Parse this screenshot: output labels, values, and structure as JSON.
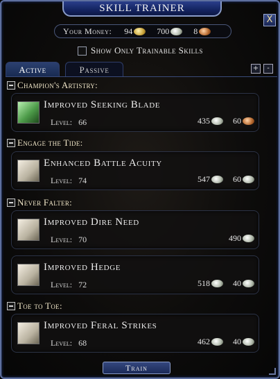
{
  "window": {
    "title": "Skill Trainer",
    "close_glyph": "X"
  },
  "money": {
    "label": "Your Money:",
    "gold": "94",
    "silver": "700",
    "copper": "8"
  },
  "filter": {
    "label": "Show Only Trainable Skills",
    "checked": false
  },
  "tabs": [
    {
      "label": "Active",
      "selected": true
    },
    {
      "label": "Passive",
      "selected": false
    }
  ],
  "sections": [
    {
      "title": "Champion's Artistry:",
      "skills": [
        {
          "name": "Improved Seeking Blade",
          "level_label": "Level:",
          "level": "66",
          "cost_silver": "435",
          "cost_other": "60",
          "other_coin": "copper",
          "icon": "seeking-blade-icon"
        }
      ]
    },
    {
      "title": "Engage the Tide:",
      "skills": [
        {
          "name": "Enhanced Battle Acuity",
          "level_label": "Level:",
          "level": "74",
          "cost_silver": "547",
          "cost_other": "60",
          "other_coin": "silver",
          "icon": "battle-acuity-icon"
        }
      ]
    },
    {
      "title": "Never Falter:",
      "skills": [
        {
          "name": "Improved Dire Need",
          "level_label": "Level:",
          "level": "70",
          "cost_silver": "490",
          "cost_other": "",
          "other_coin": "",
          "icon": "dire-need-icon"
        },
        {
          "name": "Improved Hedge",
          "level_label": "Level:",
          "level": "72",
          "cost_silver": "518",
          "cost_other": "40",
          "other_coin": "silver",
          "icon": "hedge-icon"
        }
      ]
    },
    {
      "title": "Toe to Toe:",
      "skills": [
        {
          "name": "Improved Feral Strikes",
          "level_label": "Level:",
          "level": "68",
          "cost_silver": "462",
          "cost_other": "40",
          "other_coin": "silver",
          "icon": "feral-strikes-icon"
        }
      ]
    }
  ],
  "buttons": {
    "train": "Train",
    "expand_glyph": "+",
    "collapse_glyph": "-"
  }
}
